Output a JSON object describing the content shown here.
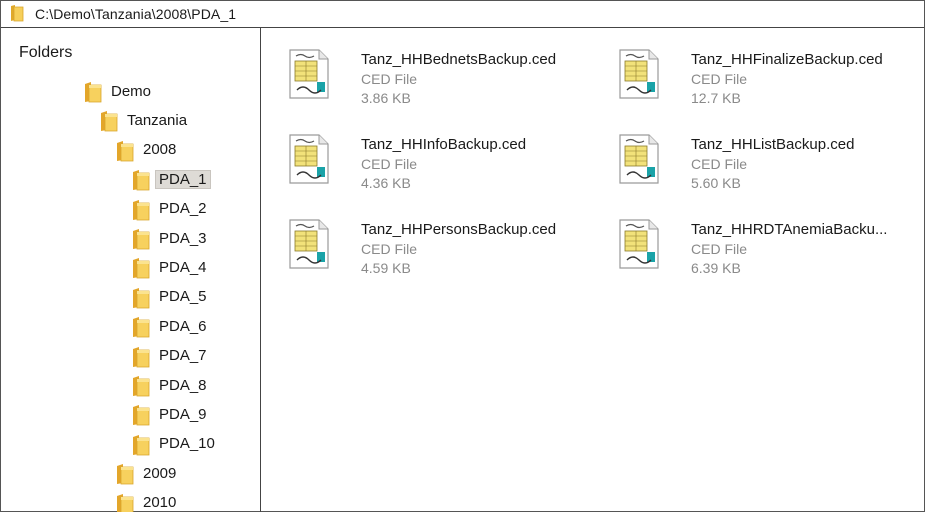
{
  "address": {
    "path": "C:\\Demo\\Tanzania\\2008\\PDA_1"
  },
  "tree": {
    "heading": "Folders",
    "items": [
      {
        "label": "Demo",
        "name": "tree-item-demo",
        "selected": false
      },
      {
        "label": "Tanzania",
        "name": "tree-item-tanzania",
        "selected": false
      },
      {
        "label": "2008",
        "name": "tree-item-2008",
        "selected": false
      },
      {
        "label": "PDA_1",
        "name": "tree-item-pda-1",
        "selected": true
      },
      {
        "label": "PDA_2",
        "name": "tree-item-pda-2",
        "selected": false
      },
      {
        "label": "PDA_3",
        "name": "tree-item-pda-3",
        "selected": false
      },
      {
        "label": "PDA_4",
        "name": "tree-item-pda-4",
        "selected": false
      },
      {
        "label": "PDA_5",
        "name": "tree-item-pda-5",
        "selected": false
      },
      {
        "label": "PDA_6",
        "name": "tree-item-pda-6",
        "selected": false
      },
      {
        "label": "PDA_7",
        "name": "tree-item-pda-7",
        "selected": false
      },
      {
        "label": "PDA_8",
        "name": "tree-item-pda-8",
        "selected": false
      },
      {
        "label": "PDA_9",
        "name": "tree-item-pda-9",
        "selected": false
      },
      {
        "label": "PDA_10",
        "name": "tree-item-pda-10",
        "selected": false
      },
      {
        "label": "2009",
        "name": "tree-item-2009",
        "selected": false
      },
      {
        "label": "2010",
        "name": "tree-item-2010",
        "selected": false
      }
    ]
  },
  "files": [
    {
      "name": "Tanz_HHBednetsBackup.ced",
      "type": "CED File",
      "size": "3.86 KB"
    },
    {
      "name": "Tanz_HHFinalizeBackup.ced",
      "type": "CED File",
      "size": "12.7 KB"
    },
    {
      "name": "Tanz_HHInfoBackup.ced",
      "type": "CED File",
      "size": "4.36 KB"
    },
    {
      "name": "Tanz_HHListBackup.ced",
      "type": "CED File",
      "size": "5.60 KB"
    },
    {
      "name": "Tanz_HHPersonsBackup.ced",
      "type": "CED File",
      "size": "4.59 KB"
    },
    {
      "name": "Tanz_HHRDTAnemiaBacku...",
      "type": "CED File",
      "size": "6.39 KB"
    }
  ],
  "icons": {
    "folder": "folder-icon",
    "file": "ced-file-icon"
  },
  "colors": {
    "folder": "#f2c040",
    "selection": "#dedbd6",
    "secondary_text": "#8a8a8a"
  }
}
